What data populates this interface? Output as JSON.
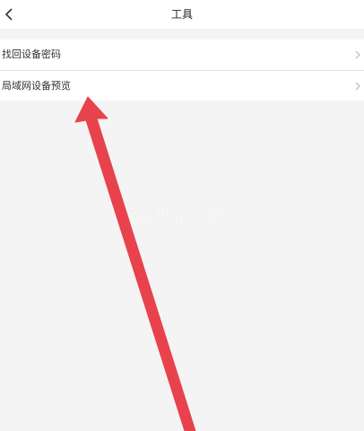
{
  "header": {
    "title": "工具",
    "back_icon": "chevron-left-icon"
  },
  "menu": {
    "items": [
      {
        "label": "找回设备密码",
        "icon": "chevron-right-icon"
      },
      {
        "label": "局域网设备预览",
        "icon": "chevron-right-icon"
      }
    ]
  },
  "watermark": {
    "text": "www.86ps.com"
  },
  "annotation": {
    "arrow_color": "#e8424c",
    "icon": "arrow-up-icon"
  },
  "colors": {
    "background": "#f4f4f4",
    "surface": "#ffffff",
    "divider": "#e6e6e6",
    "chevron": "#b8b8b8"
  }
}
